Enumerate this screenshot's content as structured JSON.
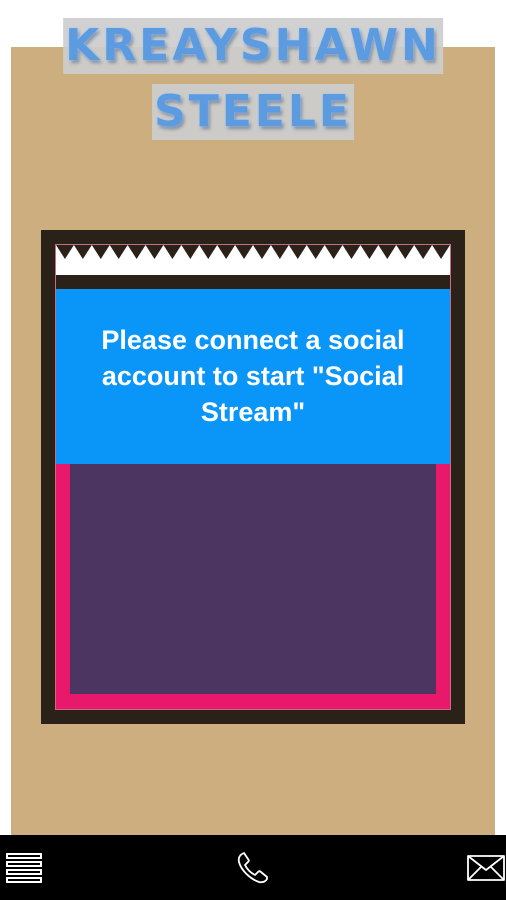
{
  "header": {
    "title_line_1": "Kreayshawn",
    "title_line_2": "Steele"
  },
  "social_stream": {
    "message": "Please connect a social account to start \"Social Stream\""
  },
  "bottom_nav": {
    "menu_icon": "menu-icon",
    "phone_icon": "phone-icon",
    "mail_icon": "mail-icon"
  },
  "colors": {
    "paper": "#cdae7e",
    "title_text": "#5c9be0",
    "frame": "#2a2119",
    "banner": "#0a95f9",
    "accent_border": "#e8186a",
    "stream_body": "#4d3561",
    "nav_bar": "#000000"
  }
}
